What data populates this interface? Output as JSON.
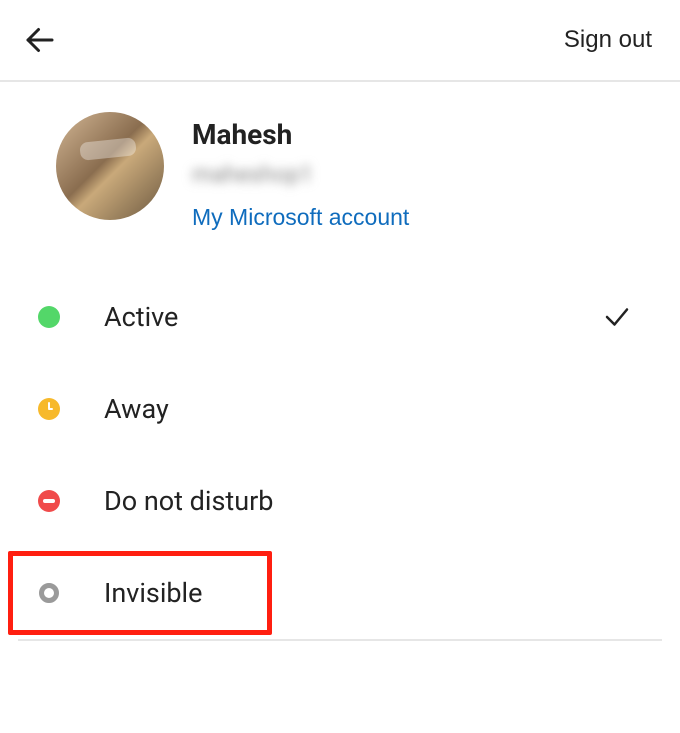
{
  "header": {
    "signout_label": "Sign out"
  },
  "profile": {
    "name": "Mahesh",
    "handle": "maheshop1",
    "link_label": "My Microsoft account"
  },
  "statuses": [
    {
      "key": "active",
      "label": "Active",
      "selected": true
    },
    {
      "key": "away",
      "label": "Away",
      "selected": false
    },
    {
      "key": "dnd",
      "label": "Do not disturb",
      "selected": false
    },
    {
      "key": "invisible",
      "label": "Invisible",
      "selected": false
    }
  ],
  "highlight": {
    "target": "invisible"
  }
}
